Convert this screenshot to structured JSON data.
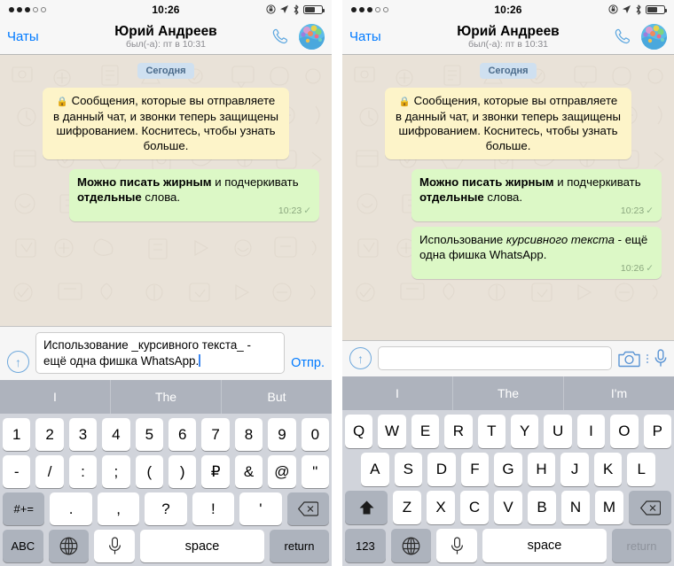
{
  "status": {
    "signal_filled": 3,
    "signal_empty": 2,
    "time": "10:26",
    "icons": [
      "rotation-lock-icon",
      "location-arrow-icon",
      "bluetooth-icon",
      "battery-icon"
    ]
  },
  "nav": {
    "back_label": "Чаты",
    "contact_name": "Юрий Андреев",
    "last_seen": "был(-а): пт в 10:31",
    "call_icon": "phone-icon",
    "avatar_icon": "contact-avatar"
  },
  "chat": {
    "date_pill": "Сегодня",
    "encryption_notice": "Сообщения, которые вы отправляете в данный чат, и звонки теперь защищены шифрованием. Коснитесь, чтобы узнать больше.",
    "lock_glyph": "🔒",
    "messages": [
      {
        "id": "bold-demo",
        "parts": [
          {
            "text": "Можно писать жирным",
            "style": "bold"
          },
          {
            "text": " и подчеркивать ",
            "style": "normal"
          },
          {
            "text": "отдельные",
            "style": "bold"
          },
          {
            "text": " слова.",
            "style": "normal"
          }
        ],
        "time": "10:23",
        "tick": "✓"
      },
      {
        "id": "italic-demo",
        "parts": [
          {
            "text": "Использование ",
            "style": "normal"
          },
          {
            "text": "курсивного текста",
            "style": "italic"
          },
          {
            "text": " - ещё одна фишка WhatsApp.",
            "style": "normal"
          }
        ],
        "time": "10:26",
        "tick": "✓"
      }
    ]
  },
  "left_panel": {
    "input_value": "Использование _курсивного текста_  - ещё одна фишка WhatsApp.",
    "send_label": "Отпр.",
    "attach_icon": "attach-up-arrow-icon",
    "suggestions": [
      "I",
      "The",
      "But"
    ],
    "keyboard_type": "numeric",
    "rows": {
      "row1": [
        "1",
        "2",
        "3",
        "4",
        "5",
        "6",
        "7",
        "8",
        "9",
        "0"
      ],
      "row2": [
        "-",
        "/",
        ":",
        ";",
        "(",
        ")",
        "₽",
        "&",
        "@",
        "\""
      ],
      "row3_mod": "#+=",
      "row3": [
        ".",
        ",",
        "?",
        "!",
        "'"
      ],
      "row3_backspace": "backspace-icon",
      "bottom_switch": "ABC",
      "bottom_globe": "globe-icon",
      "bottom_mic": "microphone-icon",
      "bottom_space": "space",
      "bottom_return": "return"
    }
  },
  "right_panel": {
    "input_value": "",
    "attach_icon": "attach-up-arrow-icon",
    "camera_icon": "camera-icon",
    "kebab_icon": "more-options-icon",
    "mic_icon": "microphone-icon",
    "suggestions": [
      "I",
      "The",
      "I'm"
    ],
    "keyboard_type": "qwerty",
    "rows": {
      "row1": [
        "Q",
        "W",
        "E",
        "R",
        "T",
        "Y",
        "U",
        "I",
        "O",
        "P"
      ],
      "row2": [
        "A",
        "S",
        "D",
        "F",
        "G",
        "H",
        "J",
        "K",
        "L"
      ],
      "row3_shift": "shift-icon",
      "row3": [
        "Z",
        "X",
        "C",
        "V",
        "B",
        "N",
        "M"
      ],
      "row3_backspace": "backspace-icon",
      "bottom_switch": "123",
      "bottom_globe": "globe-icon",
      "bottom_mic": "microphone-icon",
      "bottom_space": "space",
      "bottom_return": "return"
    }
  },
  "colors": {
    "chat_bg": "#e9e2d8",
    "outgoing_bubble": "#dcf8c6",
    "system_bubble": "#fdf4c9",
    "date_pill": "#cfe0f0",
    "accent_blue": "#007aff",
    "keyboard_bg": "#d1d4db"
  }
}
